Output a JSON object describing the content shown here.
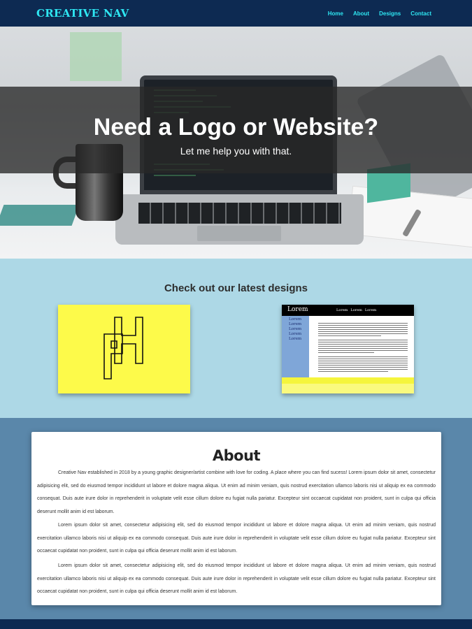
{
  "nav": {
    "brand": "CREATIVE NAV",
    "links": [
      "Home",
      "About",
      "Designs",
      "Contact"
    ],
    "accent_color": "#2ee6f2",
    "background": "#0d2a52"
  },
  "hero": {
    "title": "Need a Logo or Website?",
    "subtitle": "Let me help you with that."
  },
  "designs": {
    "heading": "Check out our latest designs",
    "mockup": {
      "logo": "Lorem",
      "nav": [
        "Lorem",
        "Lorem",
        "Lorem"
      ],
      "sidebar": [
        "Lorem",
        "Lorem",
        "Lorem",
        "Lorem",
        "Lorem"
      ]
    },
    "background": "#add8e6"
  },
  "about": {
    "title": "About",
    "paragraphs": [
      "Creative Nav established in 2018 by a young graphic designer/artist combine with love for coding. A place where you can find sucess! Lorem ipsum dolor sit amet, consectetur adipisicing elit, sed do eiusmod tempor incididunt ut labore et dolore magna aliqua. Ut enim ad minim veniam, quis nostrud exercitation ullamco laboris nisi ut aliquip ex ea commodo consequat. Duis aute irure dolor in reprehenderit in voluptate velit esse cillum dolore eu fugiat nulla pariatur. Excepteur sint occaecat cupidatat non proident, sunt in culpa qui officia deserunt mollit anim id est laborum.",
      "Lorem ipsum dolor sit amet, consectetur adipisicing elit, sed do eiusmod tempor incididunt ut labore et dolore magna aliqua. Ut enim ad minim veniam, quis nostrud exercitation ullamco laboris nisi ut aliquip ex ea commodo consequat. Duis aute irure dolor in reprehenderit in voluptate velit esse cillum dolore eu fugiat nulla pariatur. Excepteur sint occaecat cupidatat non proident, sunt in culpa qui officia deserunt mollit anim id est laborum.",
      "Lorem ipsum dolor sit amet, consectetur adipisicing elit, sed do eiusmod tempor incididunt ut labore et dolore magna aliqua. Ut enim ad minim veniam, quis nostrud exercitation ullamco laboris nisi ut aliquip ex ea commodo consequat. Duis aute irure dolor in reprehenderit in voluptate velit esse cillum dolore eu fugiat nulla pariatur. Excepteur sint occaecat cupidatat non proident, sunt in culpa qui officia deserunt mollit anim id est laborum."
    ],
    "background": "#5a87aa"
  }
}
